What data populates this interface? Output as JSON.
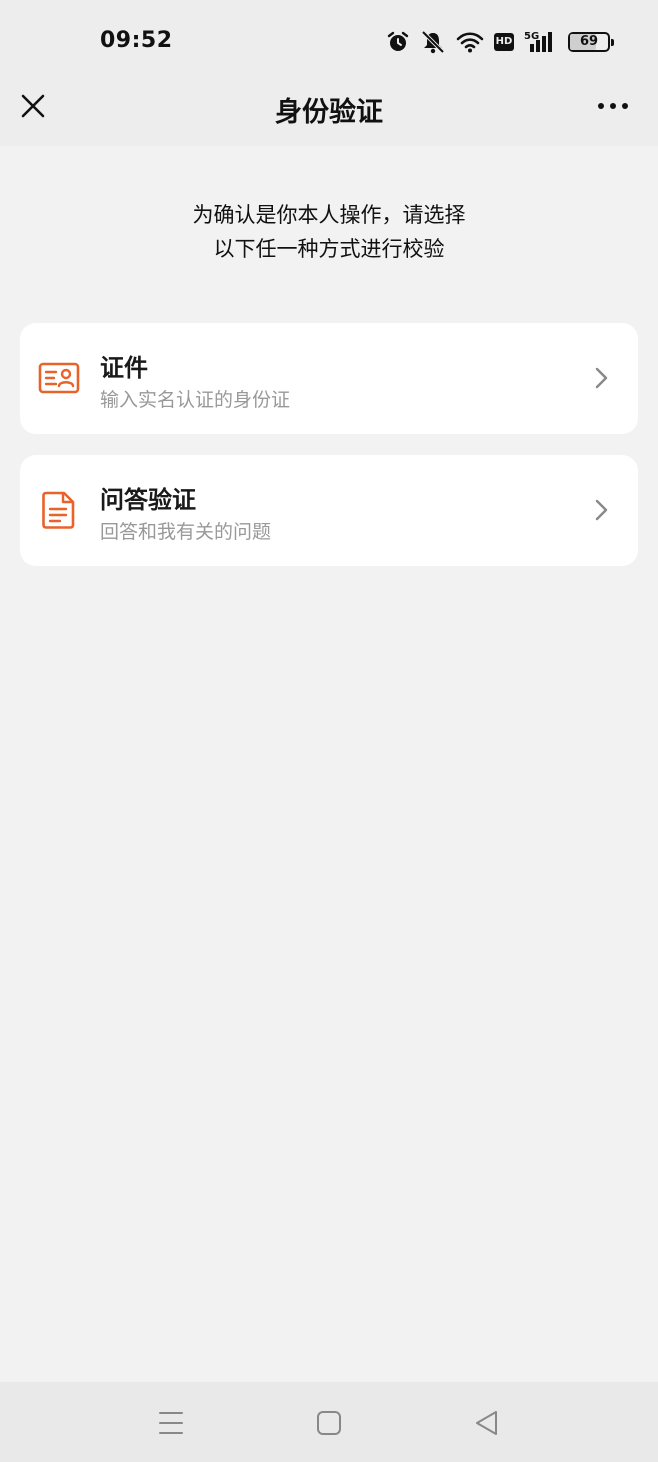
{
  "status_bar": {
    "time": "09:52",
    "icons": [
      "alarm-icon",
      "mute-bell-icon",
      "wifi-icon",
      "hd-icon",
      "5g-signal-icon",
      "battery-icon"
    ],
    "hd_label": "HD",
    "network_label": "5G",
    "battery_level": 69,
    "battery_label": "69"
  },
  "nav": {
    "title": "身份验证",
    "close_icon": "close-icon",
    "more_icon": "more-icon"
  },
  "intro": {
    "line1": "为确认是你本人操作，请选择",
    "line2": "以下任一种方式进行校验"
  },
  "options": [
    {
      "title": "证件",
      "subtitle": "输入实名认证的身份证",
      "icon": "id-card-icon"
    },
    {
      "title": "问答验证",
      "subtitle": "回答和我有关的问题",
      "icon": "document-icon"
    }
  ],
  "colors": {
    "accent": "#e8622a",
    "background": "#f2f2f2",
    "card": "#ffffff",
    "subtitle": "#999999"
  },
  "system_nav": {
    "buttons": [
      "menu-icon",
      "home-icon",
      "back-icon"
    ]
  }
}
